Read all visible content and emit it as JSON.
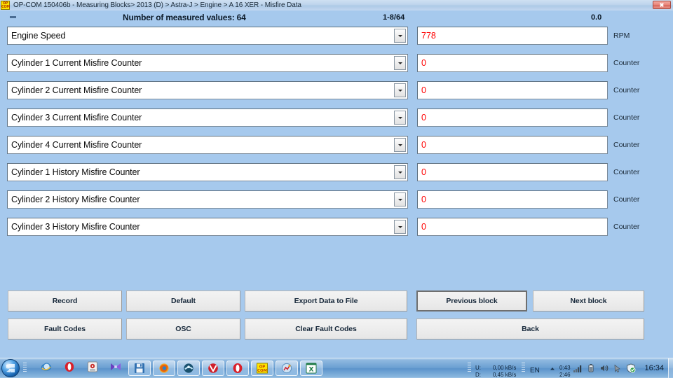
{
  "window": {
    "icon_line1": "OP",
    "icon_line2": "COM",
    "title": "OP-COM 150406b - Measuring Blocks> 2013 (D) > Astra-J > Engine > A 16 XER - Misfire Data",
    "close_label": "✖"
  },
  "header": {
    "title": "Number of measured values: 64",
    "range": "1-8/64",
    "value": "0.0"
  },
  "rows": [
    {
      "label": "Engine Speed",
      "value": "778",
      "unit": "RPM"
    },
    {
      "label": "Cylinder 1 Current Misfire Counter",
      "value": "0",
      "unit": "Counter"
    },
    {
      "label": "Cylinder 2 Current Misfire Counter",
      "value": "0",
      "unit": "Counter"
    },
    {
      "label": "Cylinder 3 Current Misfire Counter",
      "value": "0",
      "unit": "Counter"
    },
    {
      "label": "Cylinder 4 Current Misfire Counter",
      "value": "0",
      "unit": "Counter"
    },
    {
      "label": "Cylinder 1 History Misfire Counter",
      "value": "0",
      "unit": "Counter"
    },
    {
      "label": "Cylinder 2 History Misfire Counter",
      "value": "0",
      "unit": "Counter"
    },
    {
      "label": "Cylinder 3 History Misfire Counter",
      "value": "0",
      "unit": "Counter"
    }
  ],
  "buttons": {
    "record": "Record",
    "default": "Default",
    "export": "Export Data to File",
    "previous_block": "Previous block",
    "next_block": "Next block",
    "fault_codes": "Fault Codes",
    "osc": "OSC",
    "clear_fault_codes": "Clear Fault Codes",
    "back": "Back"
  },
  "taskbar": {
    "tray": {
      "upload_label": "U:",
      "download_label": "D:",
      "upload_rate": "0,00 kB/s",
      "download_rate": "0,45 kB/s",
      "language": "EN",
      "media_elapsed": "0:43",
      "media_total": "2:46",
      "clock": "16:34"
    }
  },
  "colors": {
    "background": "#a6c9ed",
    "value_text": "#ff0000",
    "accent": "#5b93cb"
  }
}
